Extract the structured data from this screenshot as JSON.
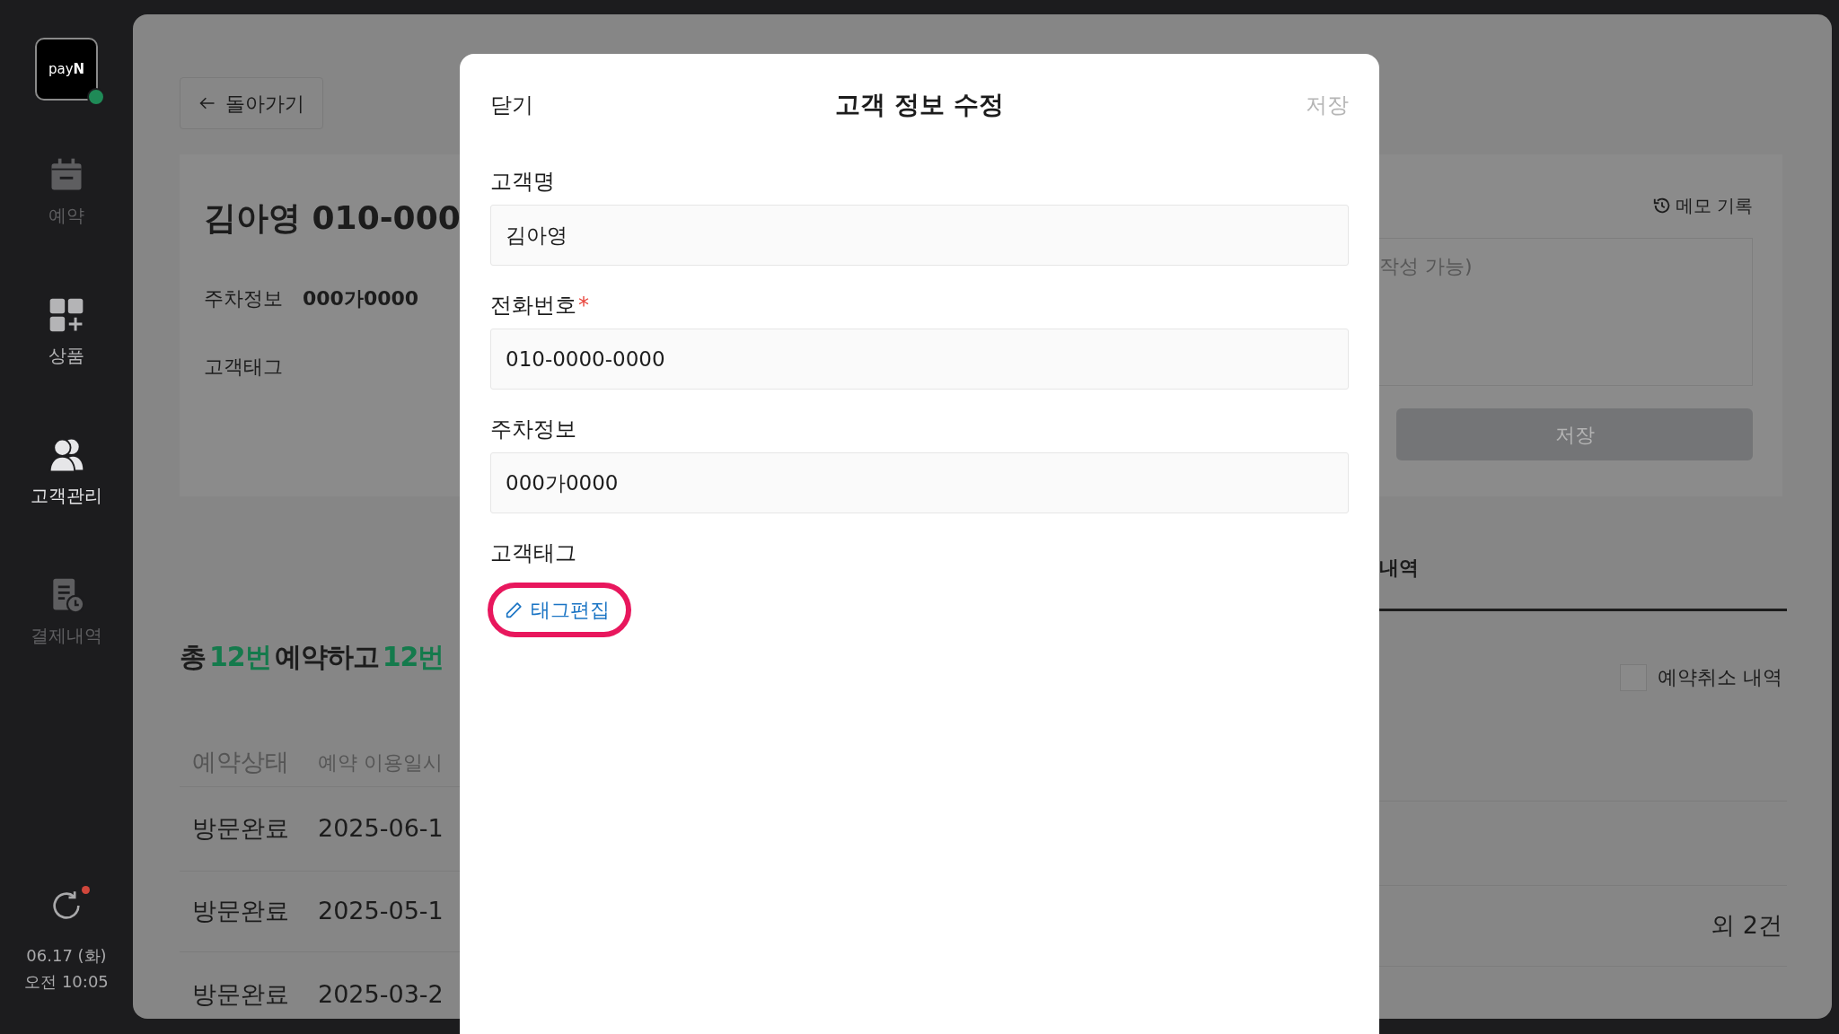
{
  "sidebar": {
    "logo": "pay**N**",
    "items": [
      {
        "label": "예약",
        "kind": "calendar",
        "selected": false,
        "disabled": true
      },
      {
        "label": "상품",
        "kind": "grid",
        "selected": false,
        "disabled": false
      },
      {
        "label": "고객관리",
        "kind": "people",
        "selected": true,
        "disabled": false
      },
      {
        "label": "결제내역",
        "kind": "receipt",
        "selected": false,
        "disabled": true
      }
    ],
    "sync": {
      "unread": true
    },
    "date": "06.17 (화)",
    "time": "오전 10:05"
  },
  "back_button": "돌아가기",
  "customer_card": {
    "name": "김아영 010-000",
    "fields": [
      {
        "label": "주차정보",
        "value": "000가0000"
      },
      {
        "label": "고객태그"
      }
    ]
  },
  "memo": {
    "history_link": "메모 기록",
    "placeholder": "작성 가능)",
    "save_button": {
      "label": "저장",
      "disabled": true
    }
  },
  "tabs": [
    {
      "label": "내역",
      "selected": true
    }
  ],
  "summary": [
    {
      "text": "총",
      "highlight": false
    },
    {
      "text": "12번",
      "highlight": true
    },
    {
      "text": "예약하고",
      "highlight": false
    },
    {
      "text": "12번",
      "highlight": true
    }
  ],
  "cancel_filter": {
    "label": "예약취소 내역",
    "checked": false
  },
  "table": {
    "columns": [
      "예약상태",
      "예약 이용일시"
    ],
    "rows": [
      {
        "status": "방문완료",
        "date": "2025-06-1"
      },
      {
        "status": "방문완료",
        "date": "2025-05-1",
        "note": "외 2건"
      },
      {
        "status": "방문완료",
        "date": "2025-03-2"
      }
    ]
  },
  "modal": {
    "close": "닫기",
    "title": "고객 정보 수정",
    "save": {
      "label": "저장",
      "disabled": true
    },
    "fields": [
      {
        "label": "고객명",
        "value": "김아영"
      },
      {
        "label": "전화번호",
        "required_mark": "*",
        "value": "010-0000-0000"
      },
      {
        "label": "주차정보",
        "value": "000가0000"
      }
    ],
    "tag_label": "고객태그",
    "tag_button": {
      "label": "태그편집",
      "highlighted": true
    }
  }
}
